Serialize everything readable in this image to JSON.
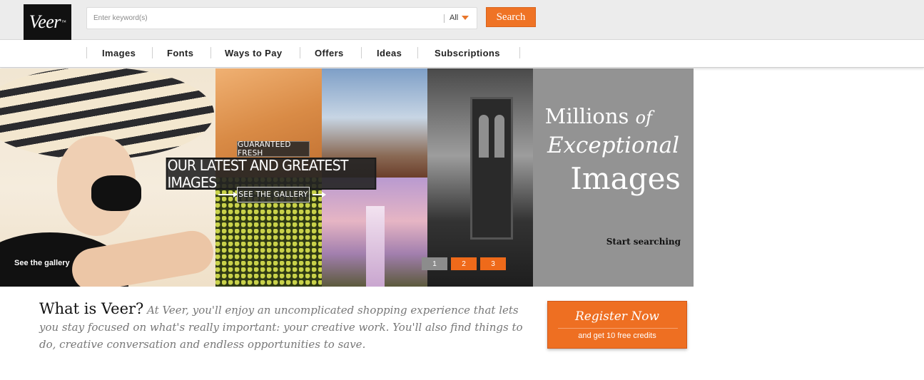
{
  "header": {
    "logo_text": "Veer",
    "logo_mark": "™",
    "search_placeholder": "Enter keyword(s)",
    "scope_value": "All",
    "search_button": "Search"
  },
  "nav": {
    "items": [
      "Images",
      "Fonts",
      "Ways to Pay",
      "Offers",
      "Ideas",
      "Subscriptions"
    ]
  },
  "hero": {
    "badge_top": "GUARANTEED FRESH",
    "badge_main": "OUR LATEST AND GREATEST IMAGES",
    "badge_cta": "SEE THE GALLERY",
    "corner_link": "See the gallery",
    "pages": [
      "1",
      "2",
      "3"
    ],
    "promo": {
      "line1_a": "Millions",
      "line1_b": "of",
      "line2": "Exceptional",
      "line3": "Images",
      "cta": "Start searching"
    }
  },
  "about": {
    "title": "What is Veer?",
    "body": "At Veer, you'll enjoy an uncomplicated shopping experience that lets you stay focused on what's really important: your creative work. You'll also find things to do, creative conversation and endless opportunities to save."
  },
  "register": {
    "main": "Register Now",
    "sub": "and get 10 free credits"
  },
  "colors": {
    "accent": "#ef7325",
    "promo_grey": "#939393",
    "header_bg": "#ececec"
  }
}
